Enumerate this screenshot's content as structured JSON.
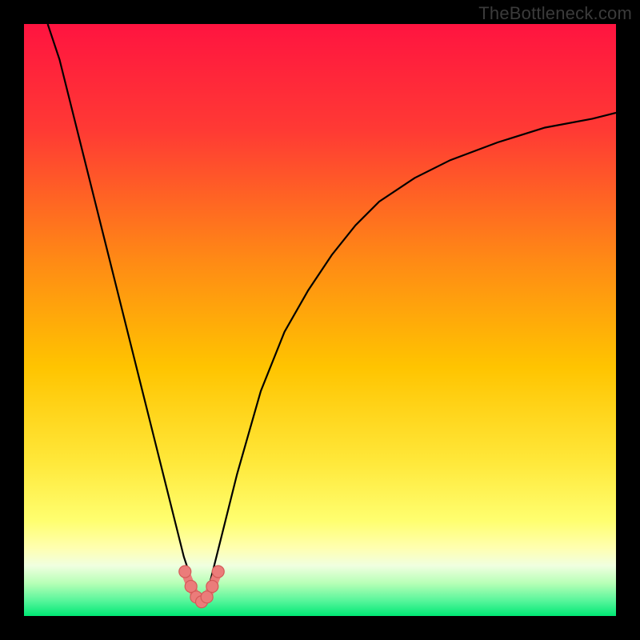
{
  "attribution": {
    "text": "TheBottleneck.com"
  },
  "colors": {
    "black": "#000000",
    "gradient_top": "#ff1440",
    "gradient_upper": "#ff4a30",
    "gradient_mid": "#ffb000",
    "gradient_lower": "#ffe040",
    "gradient_yellow_pale": "#ffff8c",
    "gradient_green_pale": "#b6ffb6",
    "gradient_green": "#00e874",
    "dot": "#eb7c7a"
  },
  "chart_data": {
    "type": "line",
    "title": "",
    "xlabel": "",
    "ylabel": "",
    "xlim": [
      0,
      100
    ],
    "ylim": [
      0,
      100
    ],
    "grid": false,
    "series": [
      {
        "name": "bottleneck-curve",
        "x": [
          4,
          6,
          8,
          10,
          12,
          14,
          16,
          18,
          20,
          22,
          24,
          26,
          27,
          28,
          29,
          29.5,
          30,
          30.5,
          31,
          32,
          34,
          36,
          38,
          40,
          44,
          48,
          52,
          56,
          60,
          66,
          72,
          80,
          88,
          96,
          100
        ],
        "y": [
          100,
          94,
          86,
          78,
          70,
          62,
          54,
          46,
          38,
          30,
          22,
          14,
          10,
          7,
          4,
          2.5,
          2,
          2.5,
          4,
          8,
          16,
          24,
          31,
          38,
          48,
          55,
          61,
          66,
          70,
          74,
          77,
          80,
          82.5,
          84,
          85
        ]
      },
      {
        "name": "marker-dots",
        "x": [
          27.2,
          28.2,
          29.1,
          30.0,
          30.9,
          31.8,
          32.8
        ],
        "y": [
          7.5,
          5.0,
          3.2,
          2.4,
          3.2,
          5.0,
          7.5
        ]
      }
    ],
    "annotations": []
  }
}
